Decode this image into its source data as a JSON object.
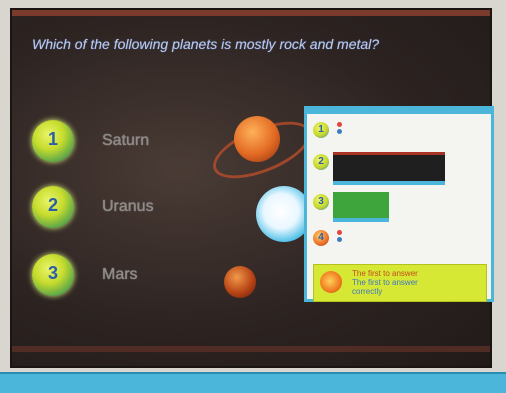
{
  "question": "Which of the following planets is mostly rock and metal?",
  "options": [
    {
      "number": "1",
      "label": "Saturn"
    },
    {
      "number": "2",
      "label": "Uranus"
    },
    {
      "number": "3",
      "label": "Mars"
    }
  ],
  "panel": {
    "rows": [
      {
        "number": "1",
        "bar": null
      },
      {
        "number": "2",
        "bar": "#1f1f1f"
      },
      {
        "number": "3",
        "bar": "#3ea43c"
      },
      {
        "number": "4",
        "bar": null
      }
    ],
    "winner": {
      "line1": "The first to answer",
      "line2": "The first to answer",
      "line3": "correctly"
    }
  },
  "colors": {
    "accent": "#4bb6da",
    "question_text": "#b8c9ef",
    "badge": "#c6dc2d",
    "winner_bg": "#d7e834"
  }
}
